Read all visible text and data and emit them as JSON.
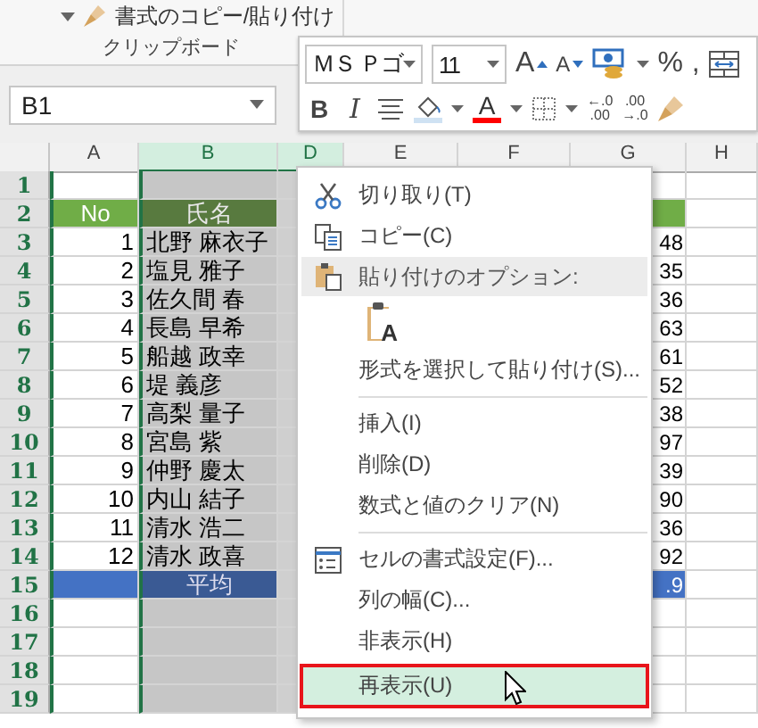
{
  "ribbon": {
    "format_painter": "書式のコピー/貼り付け",
    "group_label": "クリップボード"
  },
  "name_box": {
    "value": "B1"
  },
  "mini_toolbar": {
    "font": "ＭＳ Ｐゴ",
    "size": "11",
    "grow_font": "A",
    "shrink_font": "A",
    "percent": "%",
    "comma": ",",
    "bold": "B",
    "italic": "I",
    "font_color": "A",
    "increase_decimal": {
      "top": "←.0",
      "bottom": ".00"
    },
    "decrease_decimal": {
      "top": ".00",
      "bottom": "→.0"
    }
  },
  "sheet": {
    "columns": [
      {
        "label": "A",
        "selected": false
      },
      {
        "label": "B",
        "selected": true
      },
      {
        "label": "D",
        "selected": true
      },
      {
        "label": "E",
        "selected": false
      },
      {
        "label": "F",
        "selected": false
      },
      {
        "label": "G",
        "selected": false
      },
      {
        "label": "H",
        "selected": false
      }
    ],
    "rows": [
      {
        "number": "1",
        "kind": "blank"
      },
      {
        "number": "2",
        "kind": "header",
        "a": "No",
        "b": "氏名"
      },
      {
        "number": "3",
        "kind": "data",
        "a": "1",
        "b": "北野 麻衣子",
        "g": "48"
      },
      {
        "number": "4",
        "kind": "data",
        "a": "2",
        "b": "塩見 雅子",
        "g": "35"
      },
      {
        "number": "5",
        "kind": "data",
        "a": "3",
        "b": "佐久間 春",
        "g": "36"
      },
      {
        "number": "6",
        "kind": "data",
        "a": "4",
        "b": "長島 早希",
        "g": "63"
      },
      {
        "number": "7",
        "kind": "data",
        "a": "5",
        "b": "船越 政幸",
        "g": "61"
      },
      {
        "number": "8",
        "kind": "data",
        "a": "6",
        "b": "堤 義彦",
        "g": "52"
      },
      {
        "number": "9",
        "kind": "data",
        "a": "7",
        "b": "高梨 量子",
        "g": "38"
      },
      {
        "number": "10",
        "kind": "data",
        "a": "8",
        "b": "宮島 紫",
        "g": "97"
      },
      {
        "number": "11",
        "kind": "data",
        "a": "9",
        "b": "仲野 慶太",
        "g": "39"
      },
      {
        "number": "12",
        "kind": "data",
        "a": "10",
        "b": "内山 結子",
        "g": "90"
      },
      {
        "number": "13",
        "kind": "data",
        "a": "11",
        "b": "清水 浩二",
        "g": "36"
      },
      {
        "number": "14",
        "kind": "data",
        "a": "12",
        "b": "清水 政喜",
        "g": "92"
      },
      {
        "number": "15",
        "kind": "total",
        "b": "平均",
        "g": ".9"
      },
      {
        "number": "16",
        "kind": "blank"
      },
      {
        "number": "17",
        "kind": "blank"
      },
      {
        "number": "18",
        "kind": "blank"
      },
      {
        "number": "19",
        "kind": "blank"
      }
    ]
  },
  "context_menu": [
    {
      "kind": "item",
      "label": "切り取り(T)",
      "selected": false
    },
    {
      "kind": "item",
      "label": "コピー(C)",
      "selected": false
    },
    {
      "kind": "heading",
      "label": "貼り付けのオプション:"
    },
    {
      "kind": "paste-option",
      "letter": "A"
    },
    {
      "kind": "item",
      "label": "形式を選択して貼り付け(S)...",
      "selected": false
    },
    {
      "kind": "separator"
    },
    {
      "kind": "item",
      "label": "挿入(I)",
      "selected": false
    },
    {
      "kind": "item",
      "label": "削除(D)",
      "selected": false
    },
    {
      "kind": "item",
      "label": "数式と値のクリア(N)",
      "selected": false
    },
    {
      "kind": "separator"
    },
    {
      "kind": "item",
      "label": "セルの書式設定(F)...",
      "selected": false
    },
    {
      "kind": "item",
      "label": "列の幅(C)...",
      "selected": false
    },
    {
      "kind": "item",
      "label": "非表示(H)",
      "selected": false
    },
    {
      "kind": "item",
      "label": "再表示(U)",
      "selected": true
    }
  ]
}
